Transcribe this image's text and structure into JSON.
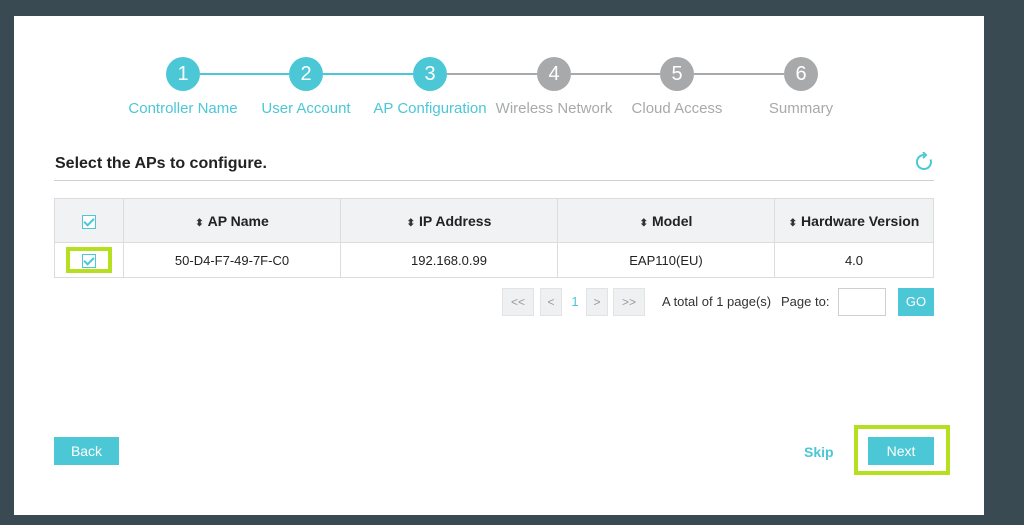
{
  "colors": {
    "accent": "#4cc7d6",
    "inactive": "#a7a9ab",
    "highlight": "#b6e01f"
  },
  "steps": [
    {
      "number": "1",
      "label": "Controller Name",
      "status": "done"
    },
    {
      "number": "2",
      "label": "User Account",
      "status": "done"
    },
    {
      "number": "3",
      "label": "AP Configuration",
      "status": "current"
    },
    {
      "number": "4",
      "label": "Wireless Network",
      "status": "todo"
    },
    {
      "number": "5",
      "label": "Cloud Access",
      "status": "todo"
    },
    {
      "number": "6",
      "label": "Summary",
      "status": "todo"
    }
  ],
  "section": {
    "title": "Select the APs to configure."
  },
  "table": {
    "headers": [
      "AP Name",
      "IP Address",
      "Model",
      "Hardware Version"
    ],
    "rows": [
      {
        "ap_name": "50-D4-F7-49-7F-C0",
        "ip": "192.168.0.99",
        "model": "EAP110(EU)",
        "hw": "4.0",
        "checked": true
      }
    ]
  },
  "pagination": {
    "first": "<<",
    "prev": "<",
    "current": "1",
    "next": ">",
    "last": ">>",
    "total_text": "A total of 1 page(s)",
    "page_to_label": "Page to:",
    "go_label": "GO"
  },
  "footer": {
    "back_label": "Back",
    "skip_label": "Skip",
    "next_label": "Next"
  }
}
